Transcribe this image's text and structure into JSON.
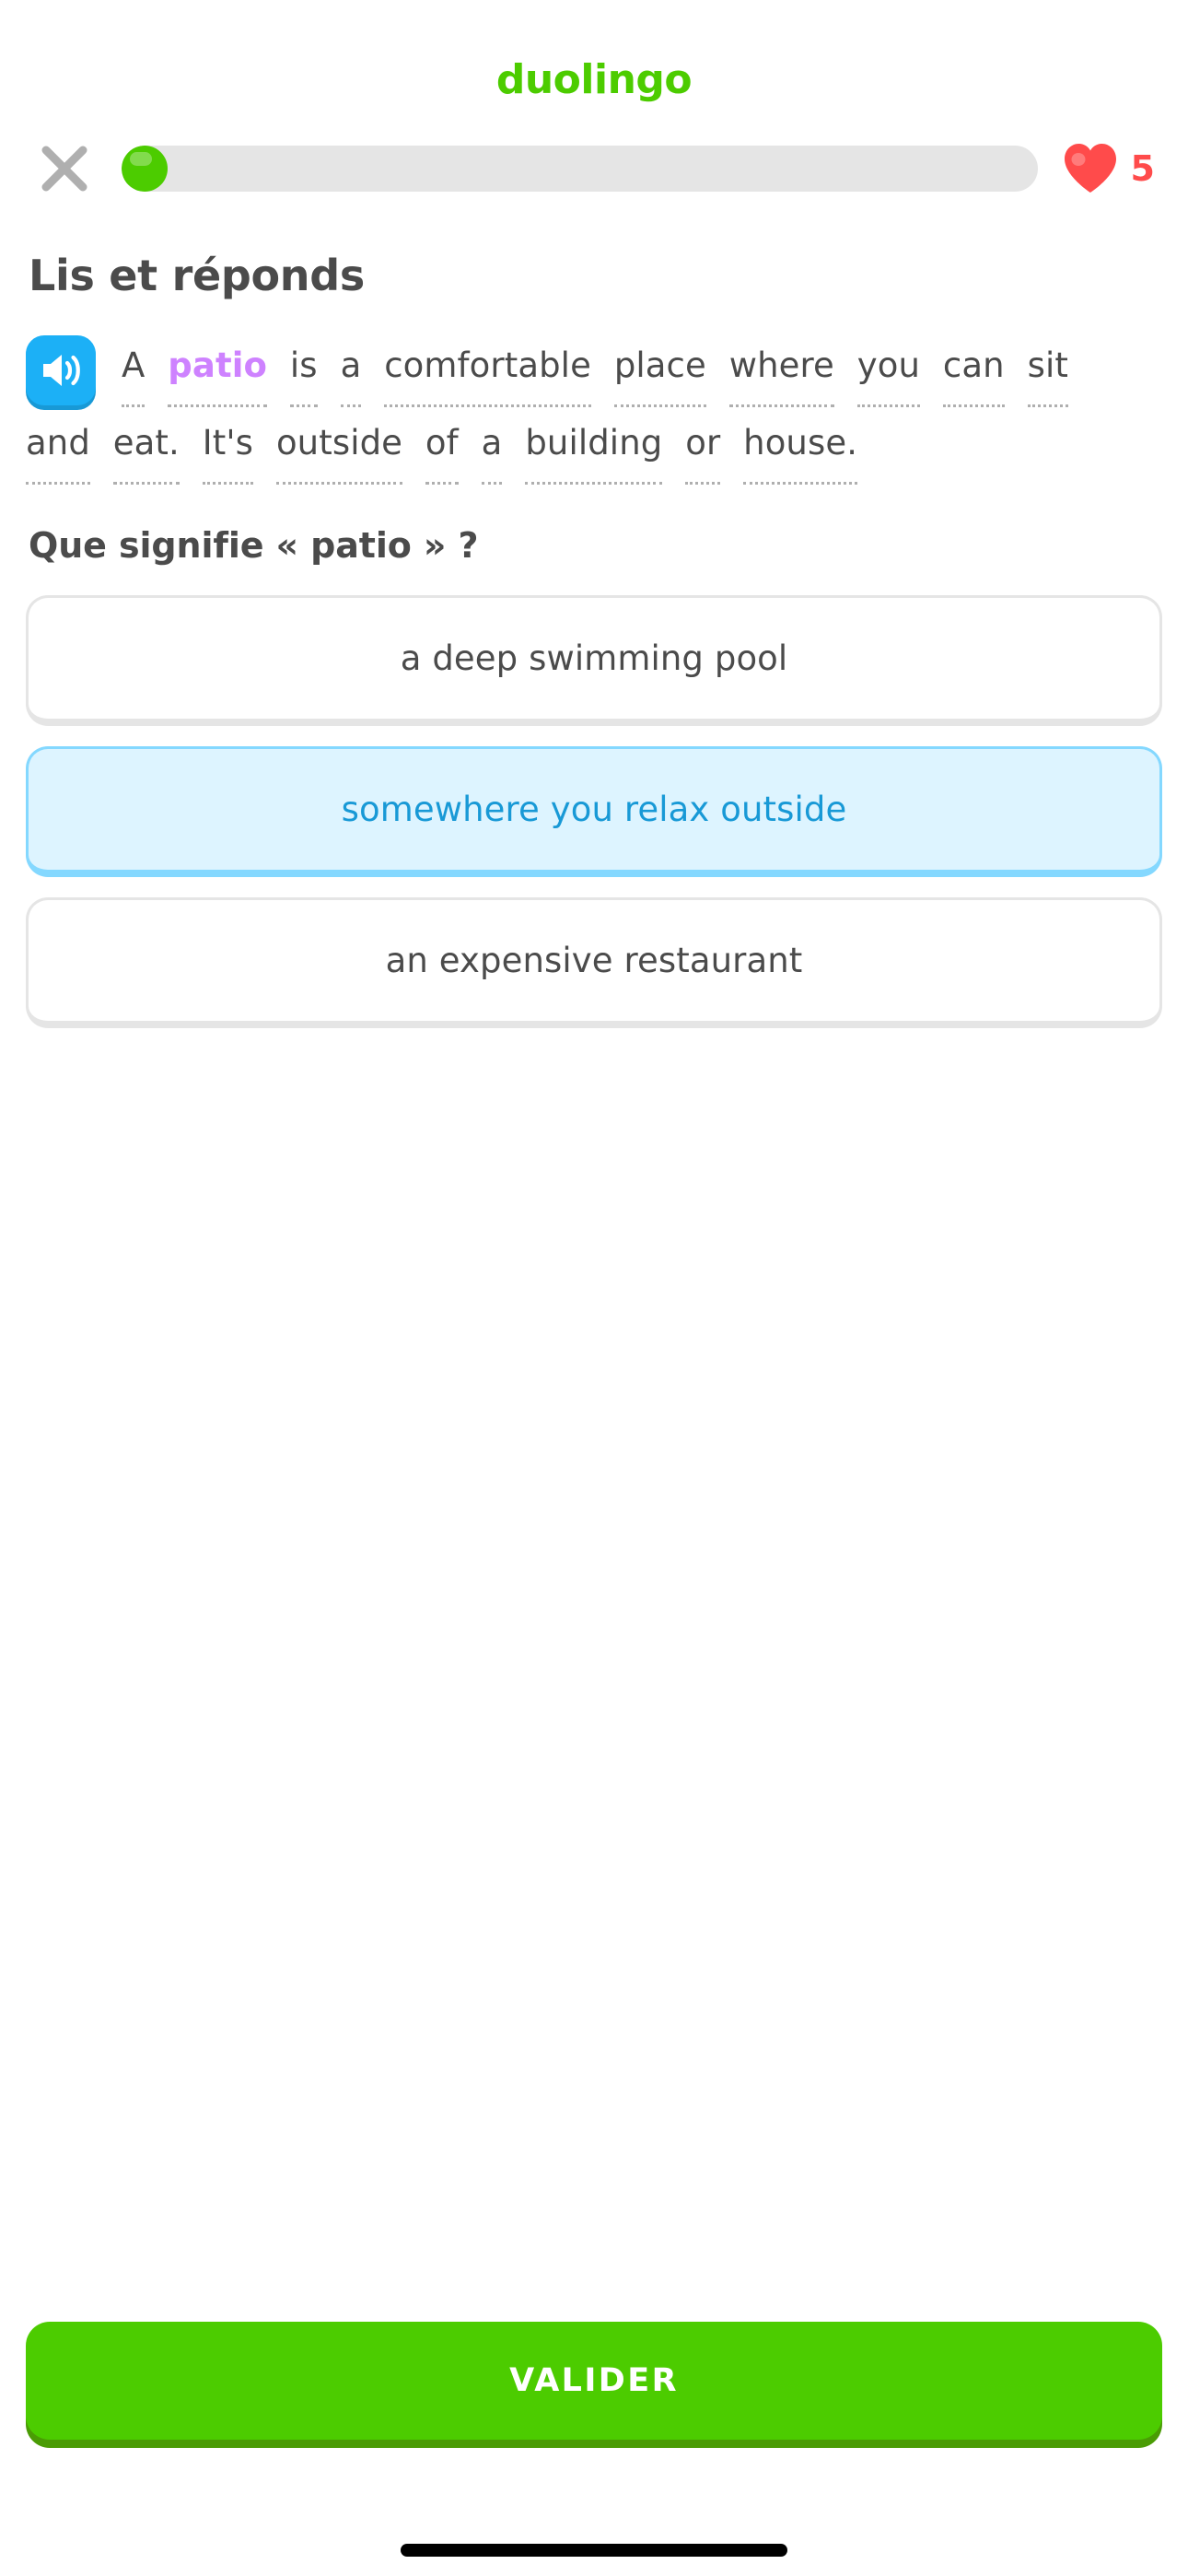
{
  "brand": {
    "wordmark": "duolingo",
    "color": "#4ccc00"
  },
  "header": {
    "close_icon": "close-x-icon",
    "progress": {
      "percent": 5,
      "fill_color": "#4ccc00",
      "track_color": "#e5e5e5"
    },
    "hearts": {
      "icon": "heart-icon",
      "count": "5",
      "color": "#ff4b4b"
    }
  },
  "exercise": {
    "title": "Lis et réponds",
    "speaker_icon": "speaker-volume-icon",
    "passage_text": "A patio is a comfortable place where you can sit and eat. It's outside of a building or house.",
    "passage_words": [
      {
        "text": "A",
        "highlight": false
      },
      {
        "text": "patio",
        "highlight": true
      },
      {
        "text": "is",
        "highlight": false
      },
      {
        "text": "a",
        "highlight": false
      },
      {
        "text": "comfortable",
        "highlight": false
      },
      {
        "text": "place",
        "highlight": false
      },
      {
        "text": "where",
        "highlight": false
      },
      {
        "text": "you",
        "highlight": false
      },
      {
        "text": "can",
        "highlight": false
      },
      {
        "text": "sit",
        "highlight": false
      },
      {
        "text": "and",
        "highlight": false
      },
      {
        "text": "eat.",
        "highlight": false
      },
      {
        "text": "It's",
        "highlight": false
      },
      {
        "text": "outside",
        "highlight": false
      },
      {
        "text": "of",
        "highlight": false
      },
      {
        "text": "a",
        "highlight": false
      },
      {
        "text": "building",
        "highlight": false
      },
      {
        "text": "or",
        "highlight": false
      },
      {
        "text": "house.",
        "highlight": false
      }
    ],
    "highlight_color": "#ce82ff",
    "question": "Que signifie « patio » ?",
    "options": [
      {
        "label": "a deep swimming pool",
        "selected": false
      },
      {
        "label": "somewhere you relax outside",
        "selected": true
      },
      {
        "label": "an expensive restaurant",
        "selected": false
      }
    ],
    "selected_option_index": 1
  },
  "footer": {
    "submit_label": "VALIDER",
    "submit_color": "#4ccc00"
  }
}
